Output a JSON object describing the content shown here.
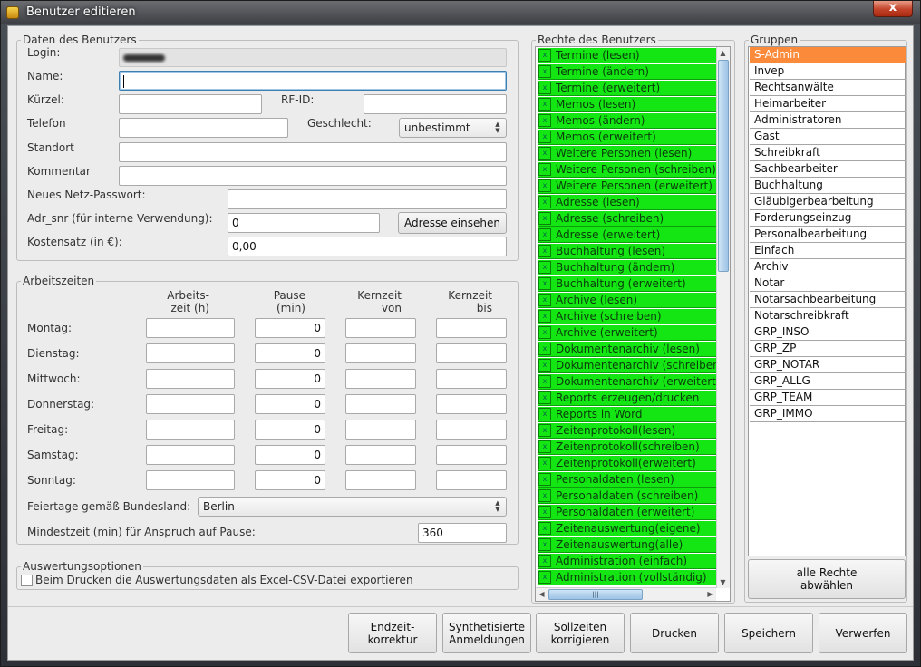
{
  "window": {
    "title": "Benutzer editieren",
    "close_label": "x"
  },
  "user": {
    "legend": "Daten des Benutzers",
    "login_label": "Login:",
    "name_label": "Name:",
    "kuerzel_label": "Kürzel:",
    "rfid_label": "RF-ID:",
    "telefon_label": "Telefon",
    "geschlecht_label": "Geschlecht:",
    "geschlecht_value": "unbestimmt",
    "standort_label": "Standort",
    "kommentar_label": "Kommentar",
    "passwort_label": "Neues Netz-Passwort:",
    "adr_label": "Adr_snr (für interne Verwendung):",
    "adr_value": "0",
    "adresse_button": "Adresse einsehen",
    "kosten_label": "Kostensatz (in €):",
    "kosten_value": "0,00"
  },
  "arbeitszeiten": {
    "legend": "Arbeitszeiten",
    "col_arbeitszeit_1": "Arbeits-",
    "col_arbeitszeit_2": "zeit (h)",
    "col_pause_1": "Pause",
    "col_pause_2": "(min)",
    "col_kernvon_1": "Kernzeit",
    "col_kernvon_2": "von",
    "col_kernbis_1": "Kernzeit",
    "col_kernbis_2": "bis",
    "days": [
      {
        "label": "Montag:",
        "pause": "0"
      },
      {
        "label": "Dienstag:",
        "pause": "0"
      },
      {
        "label": "Mittwoch:",
        "pause": "0"
      },
      {
        "label": "Donnerstag:",
        "pause": "0"
      },
      {
        "label": "Freitag:",
        "pause": "0"
      },
      {
        "label": "Samstag:",
        "pause": "0"
      },
      {
        "label": "Sonntag:",
        "pause": "0"
      }
    ],
    "feiertage_label": "Feiertage gemäß Bundesland:",
    "feiertage_value": "Berlin",
    "mindestzeit_label": "Mindestzeit (min) für Anspruch auf Pause:",
    "mindestzeit_value": "360"
  },
  "auswertung": {
    "legend": "Auswertungsoptionen",
    "csv_label": "Beim Drucken die Auswertungsdaten als Excel-CSV-Datei exportieren",
    "csv_checked": false
  },
  "rechte": {
    "legend": "Rechte des Benutzers",
    "check_mark": "x",
    "items": [
      "Termine (lesen)",
      "Termine (ändern)",
      "Termine (erweitert)",
      "Memos (lesen)",
      "Memos (ändern)",
      "Memos (erweitert)",
      "Weitere Personen (lesen)",
      "Weitere Personen (schreiben)",
      "Weitere Personen (erweitert)",
      "Adresse (lesen)",
      "Adresse (schreiben)",
      "Adresse (erweitert)",
      "Buchhaltung (lesen)",
      "Buchhaltung (ändern)",
      "Buchhaltung (erweitert)",
      "Archive (lesen)",
      "Archive (schreiben)",
      "Archive (erweitert)",
      "Dokumentenarchiv (lesen)",
      "Dokumentenarchiv (schreiben)",
      "Dokumentenarchiv (erweitert)",
      "Reports erzeugen/drucken",
      "Reports in Word",
      "Zeitenprotokoll(lesen)",
      "Zeitenprotokoll(schreiben)",
      "Zeitenprotokoll(erweitert)",
      "Personaldaten (lesen)",
      "Personaldaten (schreiben)",
      "Personaldaten (erweitert)",
      "Zeitenauswertung(eigene)",
      "Zeitenauswertung(alle)",
      "Administration (einfach)",
      "Administration (vollständig)"
    ]
  },
  "gruppen": {
    "legend": "Gruppen",
    "items": [
      "S-Admin",
      "Invep",
      "Rechtsanwälte",
      "Heimarbeiter",
      "Administratoren",
      "Gast",
      "Schreibkraft",
      "Sachbearbeiter",
      "Buchhaltung",
      "Gläubigerbearbeitung",
      "Forderungseinzug",
      "Personalbearbeitung",
      "Einfach",
      "Archiv",
      "Notar",
      "Notarsachbearbeitung",
      "Notarschreibkraft",
      "GRP_INSO",
      "GRP_ZP",
      "GRP_NOTAR",
      "GRP_ALLG",
      "GRP_TEAM",
      "GRP_IMMO"
    ],
    "selected": "S-Admin",
    "alle_rechte_1": "alle Rechte",
    "alle_rechte_2": "abwählen"
  },
  "footer": {
    "endzeit_1": "Endzeit-",
    "endzeit_2": "korrektur",
    "synth_1": "Synthetisierte",
    "synth_2": "Anmeldungen",
    "soll_1": "Sollzeiten",
    "soll_2": "korrigieren",
    "drucken": "Drucken",
    "speichern": "Speichern",
    "verwerfen": "Verwerfen"
  },
  "colors": {
    "rights_green": "#14e614",
    "group_selected": "#fb8a3a",
    "title_text": "#ffffff"
  },
  "icons": {
    "app": "app-icon",
    "close": "close-icon",
    "check": "check-icon"
  }
}
